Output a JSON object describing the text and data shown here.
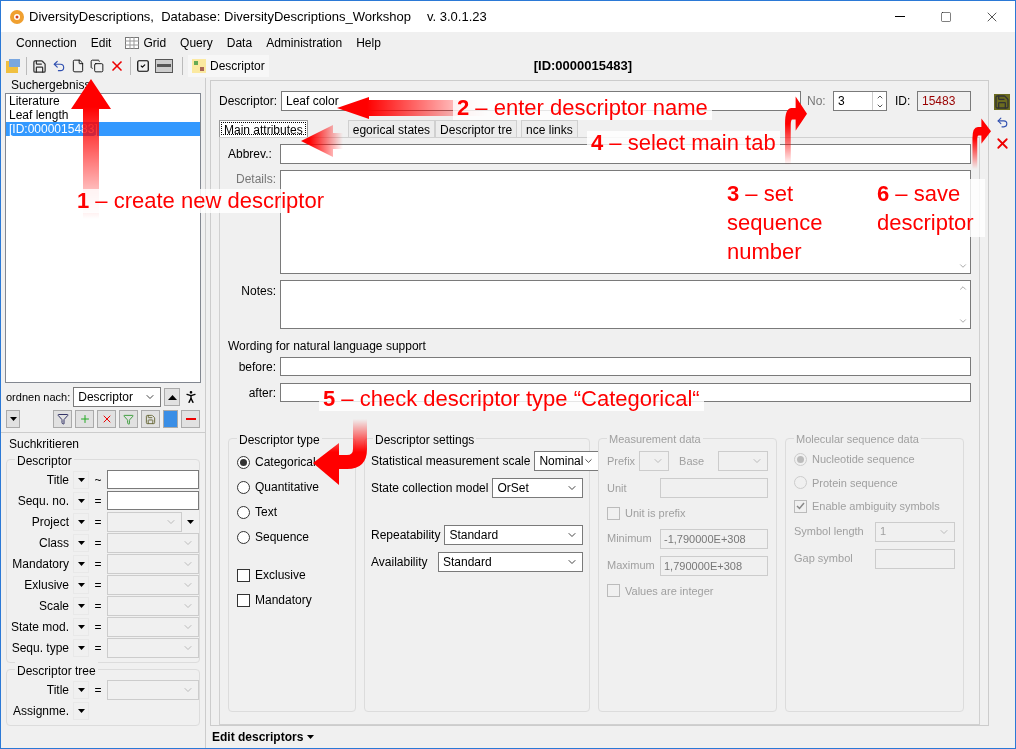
{
  "window": {
    "title": "DiversityDescriptions,  Database: DiversityDescriptions_Workshop",
    "version": "v. 3.0.1.23"
  },
  "menu": [
    "Connection",
    "Edit",
    "Grid",
    "Query",
    "Data",
    "Administration",
    "Help"
  ],
  "toolbar": {
    "descriptor_button": "Descriptor",
    "record_title": "[ID:0000015483]"
  },
  "results": {
    "title": "Suchergebniss",
    "items": [
      {
        "label": "Literature",
        "selected": false
      },
      {
        "label": "Leaf length",
        "selected": false
      },
      {
        "label": "[ID:0000015483]",
        "selected": true
      }
    ]
  },
  "sort": {
    "label": "ordnen nach:",
    "value": "Descriptor"
  },
  "search": {
    "title": "Suchkritieren",
    "groups": [
      {
        "title": "Descriptor",
        "rows": [
          {
            "label": "Title",
            "operator": "~",
            "kind": "text"
          },
          {
            "label": "Sequ. no.",
            "operator": "=",
            "kind": "text"
          },
          {
            "label": "Project",
            "operator": "=",
            "kind": "combo-extra"
          },
          {
            "label": "Class",
            "operator": "=",
            "kind": "combo"
          },
          {
            "label": "Mandatory",
            "operator": "=",
            "kind": "combo"
          },
          {
            "label": "Exlusive",
            "operator": "=",
            "kind": "combo"
          },
          {
            "label": "Scale",
            "operator": "=",
            "kind": "combo"
          },
          {
            "label": "State mod.",
            "operator": "=",
            "kind": "combo"
          },
          {
            "label": "Sequ. type",
            "operator": "=",
            "kind": "combo"
          }
        ]
      },
      {
        "title": "Descriptor tree",
        "rows": [
          {
            "label": "Title",
            "operator": "=",
            "kind": "combo"
          },
          {
            "label": "Assignme.",
            "kind": "none"
          }
        ]
      }
    ]
  },
  "form": {
    "descriptor": {
      "label": "Descriptor:",
      "value": "Leaf color"
    },
    "number": {
      "label": "No:",
      "value": "3"
    },
    "id": {
      "label": "ID:",
      "value": "15483"
    },
    "tabs": [
      {
        "label": "Main attributes",
        "selected": true
      },
      {
        "label": "egorical states",
        "selected": false
      },
      {
        "label": "Descriptor tre",
        "selected": false
      },
      {
        "label": "nce links",
        "selected": false
      }
    ],
    "abbrev": {
      "label": "Abbrev.:"
    },
    "details": {
      "label": "Details:"
    },
    "notes": {
      "label": "Notes:"
    },
    "wording": {
      "title": "Wording for natural language support",
      "before": "before:",
      "after": "after:"
    },
    "descriptor_type": {
      "title": "Descriptor type",
      "options": [
        {
          "label": "Categorical",
          "selected": true
        },
        {
          "label": "Quantitative",
          "selected": false
        },
        {
          "label": "Text",
          "selected": false
        },
        {
          "label": "Sequence",
          "selected": false
        }
      ],
      "flags": [
        {
          "label": "Exclusive",
          "checked": false
        },
        {
          "label": "Mandatory",
          "checked": false
        }
      ]
    },
    "settings": {
      "title": "Descriptor settings",
      "primary": [
        {
          "label": "Statistical measurement scale",
          "value": "Nominal"
        },
        {
          "label": "State collection model",
          "value": "OrSet"
        }
      ],
      "secondary": [
        {
          "label": "Repeatability",
          "value": "Standard"
        },
        {
          "label": "Availability",
          "value": "Standard"
        }
      ]
    },
    "measurement": {
      "title": "Measurement data",
      "disabled": true,
      "items": [
        {
          "kind": "double-select",
          "label": "Prefix",
          "label_2": "Base"
        },
        {
          "kind": "field",
          "label": "Unit"
        },
        {
          "kind": "checkbox",
          "label": "Unit is prefix",
          "checked": false
        },
        {
          "kind": "field",
          "label": "Minimum",
          "value": "-1,790000E+308"
        },
        {
          "kind": "field",
          "label": "Maximum",
          "value": "1,790000E+308"
        },
        {
          "kind": "checkbox",
          "label": "Values are integer",
          "checked": false
        }
      ]
    },
    "molecular": {
      "title": "Molecular sequence data",
      "disabled": true,
      "items": [
        {
          "kind": "radio",
          "label": "Nucleotide sequence",
          "selected": true
        },
        {
          "kind": "radio",
          "label": "Protein sequence",
          "selected": false
        },
        {
          "kind": "checkbox",
          "label": "Enable ambiguity symbols",
          "checked": true
        },
        {
          "kind": "select",
          "label": "Symbol length",
          "value": "1"
        },
        {
          "kind": "field",
          "label": "Gap symbol"
        }
      ]
    }
  },
  "footer": {
    "label": "Edit descriptors"
  },
  "callouts": [
    {
      "text": "**2** – enter descriptor name"
    },
    {
      "text": "**4** – select main tab"
    },
    {
      "text": "**1** – create new descriptor"
    },
    {
      "text": "**3** – set sequence number"
    },
    {
      "text": "**6** – save descriptor"
    },
    {
      "text": "**5** – check descriptor type “Categorical“"
    }
  ]
}
